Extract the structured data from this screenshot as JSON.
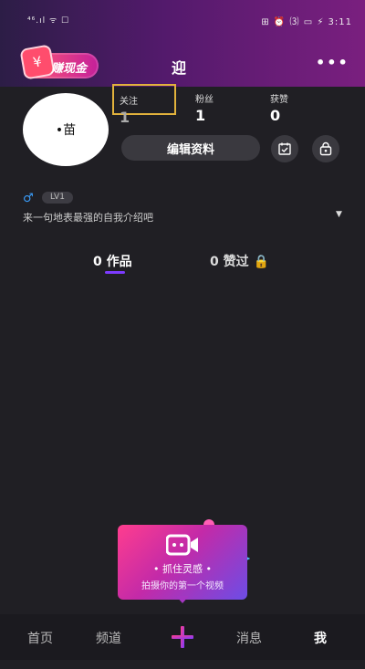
{
  "status_bar": {
    "left": "⁴⁶.ıl ᯤ ☐",
    "right": "⊞ ⏰ ⑶ ▭ ⚡ 3:11"
  },
  "header": {
    "earn_label": "赚现金",
    "username": "迎",
    "more_label": "•••"
  },
  "profile": {
    "avatar_text": "•苗",
    "stats": [
      {
        "label": "关注",
        "value": "1"
      },
      {
        "label": "粉丝",
        "value": "1"
      },
      {
        "label": "获赞",
        "value": "0"
      }
    ],
    "edit_label": "编辑资料",
    "gender_symbol": "♂",
    "level": "LV1",
    "bio": "来一句地表最强的自我介绍吧",
    "bio_arrow": "▼"
  },
  "tabs": [
    {
      "label": "0 作品",
      "active": true
    },
    {
      "label": "0 赞过 🔒",
      "active": false
    }
  ],
  "prompt": {
    "title": "• 抓住灵感 •",
    "subtitle": "拍摄你的第一个视频"
  },
  "bottom_nav": [
    {
      "label": "首页"
    },
    {
      "label": "频道"
    },
    {
      "label": "消息"
    },
    {
      "label": "我"
    }
  ],
  "colors": {
    "accent_purple": "#7d3bff",
    "following_highlight": "#e2b23c",
    "male_blue": "#3ba0ff"
  }
}
